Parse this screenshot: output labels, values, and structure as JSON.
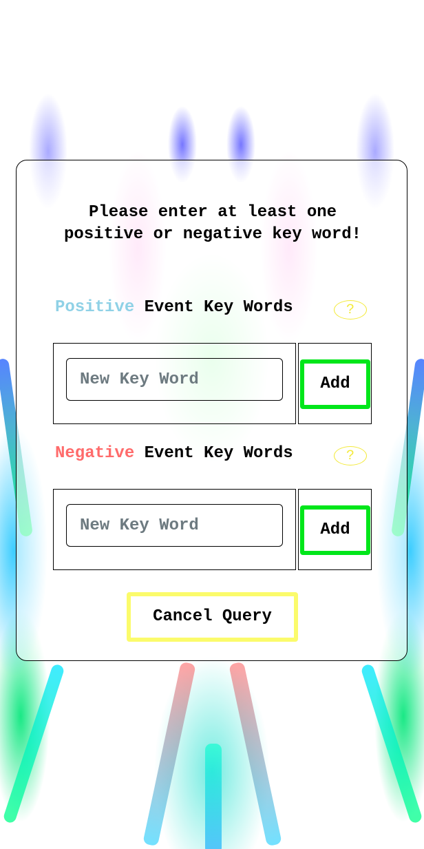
{
  "dialog": {
    "message": "Please enter at least one positive or negative key word!",
    "positive": {
      "label_colored": "Positive",
      "label_rest": " Event Key Words",
      "help": "?",
      "input_placeholder": "New Key Word",
      "input_value": "",
      "add_label": "Add"
    },
    "negative": {
      "label_colored": "Negative",
      "label_rest": " Event Key Words",
      "help": "?",
      "input_placeholder": "New Key Word",
      "input_value": "",
      "add_label": "Add"
    },
    "cancel_label": "Cancel Query"
  },
  "colors": {
    "positive": "#8fd1e6",
    "negative": "#ff6b6b",
    "add_border": "#00e61a",
    "cancel_border": "#fbfb6b",
    "help": "#f3ea3a"
  }
}
